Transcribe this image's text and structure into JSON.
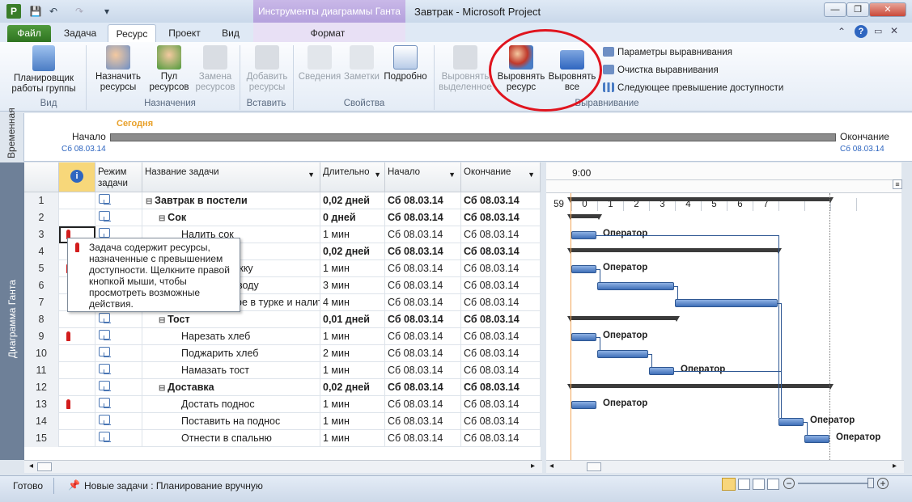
{
  "window": {
    "app_logo": "P",
    "title": "Завтрак  -  Microsoft Project",
    "context_tab": "Инструменты диаграммы Ганта",
    "qat": {
      "save_icon": "save-icon",
      "undo_icon": "undo-icon",
      "redo_icon": "redo-icon",
      "customize_icon": "chevron-down-icon"
    },
    "controls": {
      "minimize": "—",
      "restore": "❐",
      "close": "✕"
    }
  },
  "tabs": [
    {
      "label": "Файл"
    },
    {
      "label": "Задача"
    },
    {
      "label": "Ресурс"
    },
    {
      "label": "Проект"
    },
    {
      "label": "Вид"
    },
    {
      "label": "Формат"
    }
  ],
  "ribbon": {
    "groups": {
      "view": "Вид",
      "assignments": "Назначения",
      "insert": "Вставить",
      "properties": "Свойства",
      "leveling": "Выравнивание"
    },
    "buttons": {
      "team_planner": "Планировщик работы группы",
      "assign": "Назначить ресурсы",
      "pool": "Пул ресурсов",
      "replace": "Замена ресурсов",
      "add": "Добавить ресурсы",
      "info": "Сведения",
      "notes": "Заметки",
      "details": "Подробно",
      "level_selection": "Выровнять выделенное",
      "level_resource": "Выровнять ресурс",
      "level_all": "Выровнять все"
    },
    "small": {
      "options": "Параметры выравнивания",
      "clear": "Очистка выравнивания",
      "next": "Следующее превышение доступности"
    },
    "colors": {
      "highlight_ellipse": "#e0141e"
    }
  },
  "timeline": {
    "side_label": "Временная",
    "today": "Сегодня",
    "start_label": "Начало",
    "start_date": "Сб 08.03.14",
    "end_label": "Окончание",
    "end_date": "Сб 08.03.14"
  },
  "side_panel_label": "Диаграмма Ганта",
  "table": {
    "headers": {
      "info": "i",
      "mode": "Режим задачи",
      "name": "Название задачи",
      "duration": "Длительно",
      "start": "Начало",
      "finish": "Окончание"
    },
    "rows": [
      {
        "num": "1",
        "name": "Завтрак в постели",
        "duration": "0,02 дней",
        "start": "Сб 08.03.14",
        "finish": "Сб 08.03.14",
        "summary": true,
        "level": 0,
        "res": false
      },
      {
        "num": "2",
        "name": "Сок",
        "duration": "0 дней",
        "start": "Сб 08.03.14",
        "finish": "Сб 08.03.14",
        "summary": true,
        "level": 1,
        "res": false
      },
      {
        "num": "3",
        "name": "Налить сок",
        "duration": "1 мин",
        "start": "Сб 08.03.14",
        "finish": "Сб 08.03.14",
        "summary": false,
        "level": 2,
        "res": true
      },
      {
        "num": "4",
        "name": "Кофе",
        "duration": "0,02 дней",
        "start": "Сб 08.03.14",
        "finish": "Сб 08.03.14",
        "summary": true,
        "level": 1,
        "res": false
      },
      {
        "num": "5",
        "name": "Достать кружку",
        "duration": "1 мин",
        "start": "Сб 08.03.14",
        "finish": "Сб 08.03.14",
        "summary": false,
        "level": 2,
        "res": true
      },
      {
        "num": "6",
        "name": "Вскипятить воду",
        "duration": "3 мин",
        "start": "Сб 08.03.14",
        "finish": "Сб 08.03.14",
        "summary": false,
        "level": 2,
        "res": false
      },
      {
        "num": "7",
        "name": "Сварить кофе в турке и налить в кружку молоко",
        "duration": "4 мин",
        "start": "Сб 08.03.14",
        "finish": "Сб 08.03.14",
        "summary": false,
        "level": 2,
        "res": false
      },
      {
        "num": "8",
        "name": "Тост",
        "duration": "0,01 дней",
        "start": "Сб 08.03.14",
        "finish": "Сб 08.03.14",
        "summary": true,
        "level": 1,
        "res": false
      },
      {
        "num": "9",
        "name": "Нарезать хлеб",
        "duration": "1 мин",
        "start": "Сб 08.03.14",
        "finish": "Сб 08.03.14",
        "summary": false,
        "level": 2,
        "res": true
      },
      {
        "num": "10",
        "name": "Поджарить хлеб",
        "duration": "2 мин",
        "start": "Сб 08.03.14",
        "finish": "Сб 08.03.14",
        "summary": false,
        "level": 2,
        "res": false
      },
      {
        "num": "11",
        "name": "Намазать тост",
        "duration": "1 мин",
        "start": "Сб 08.03.14",
        "finish": "Сб 08.03.14",
        "summary": false,
        "level": 2,
        "res": false
      },
      {
        "num": "12",
        "name": "Доставка",
        "duration": "0,02 дней",
        "start": "Сб 08.03.14",
        "finish": "Сб 08.03.14",
        "summary": true,
        "level": 1,
        "res": false
      },
      {
        "num": "13",
        "name": "Достать поднос",
        "duration": "1 мин",
        "start": "Сб 08.03.14",
        "finish": "Сб 08.03.14",
        "summary": false,
        "level": 2,
        "res": true
      },
      {
        "num": "14",
        "name": "Поставить на поднос",
        "duration": "1 мин",
        "start": "Сб 08.03.14",
        "finish": "Сб 08.03.14",
        "summary": false,
        "level": 2,
        "res": false
      },
      {
        "num": "15",
        "name": "Отнести в спальню",
        "duration": "1 мин",
        "start": "Сб 08.03.14",
        "finish": "Сб 08.03.14",
        "summary": false,
        "level": 2,
        "res": false
      }
    ]
  },
  "tooltip": "Задача содержит ресурсы, назначенные с превышением доступности. Щелкните правой кнопкой мыши, чтобы просмотреть возможные действия.",
  "gantt": {
    "hour_label": "9:00",
    "minute_ticks": [
      "59",
      "0",
      "1",
      "2",
      "3",
      "4",
      "5",
      "6",
      "7",
      "",
      "",
      ""
    ],
    "resource_label": "Оператор"
  },
  "status": {
    "ready": "Готово",
    "new_tasks": "Новые задачи : Планирование вручную"
  }
}
